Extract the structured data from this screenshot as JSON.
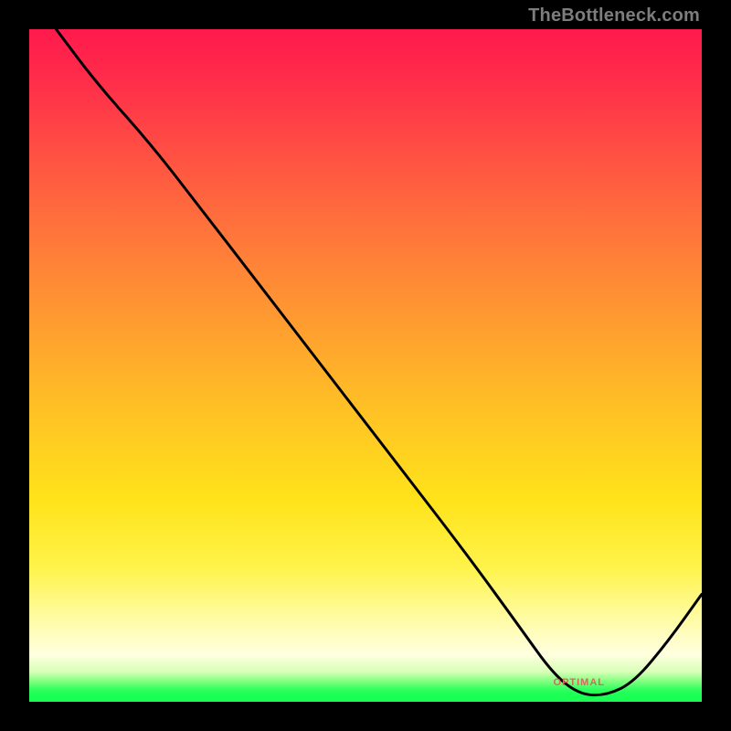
{
  "attribution": "TheBottleneck.com",
  "optimal_label": "OPTIMAL",
  "colors": {
    "top": "#ff1a4d",
    "mid": "#ffe31a",
    "bottom_green": "#1aff55",
    "curve": "#000000",
    "label": "#d46a5c",
    "attribution": "#7d7d7d"
  },
  "chart_data": {
    "type": "line",
    "title": "",
    "xlabel": "",
    "ylabel": "",
    "xlim": [
      0,
      100
    ],
    "ylim": [
      0,
      100
    ],
    "legend": false,
    "grid": false,
    "annotations": [
      {
        "text": "OPTIMAL",
        "x": 82,
        "y": 2
      }
    ],
    "series": [
      {
        "name": "bottleneck-curve",
        "x": [
          4,
          10,
          18,
          25,
          35,
          45,
          55,
          65,
          73,
          78,
          82,
          86,
          90,
          95,
          100
        ],
        "y": [
          100,
          92,
          83,
          74,
          61,
          48,
          35,
          22,
          11,
          4,
          1,
          1,
          3,
          9,
          16
        ]
      }
    ],
    "optimal_range_x": [
      78,
      88
    ]
  }
}
